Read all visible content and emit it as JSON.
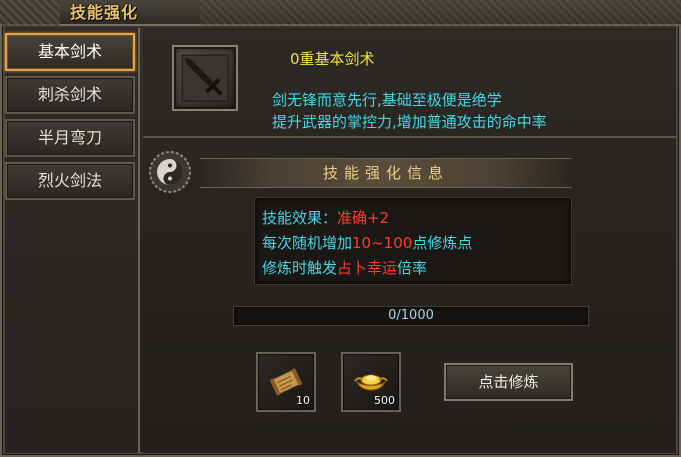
{
  "window": {
    "title": "技能强化"
  },
  "tabs": [
    {
      "label": "基本剑术",
      "active": true
    },
    {
      "label": "刺杀剑术",
      "active": false
    },
    {
      "label": "半月弯刀",
      "active": false
    },
    {
      "label": "烈火剑法",
      "active": false
    }
  ],
  "skill": {
    "icon": "sword-icon",
    "name": "0重基本剑术",
    "desc_line1": "剑无锋而意先行,基础至极便是绝学",
    "desc_line2": "提升武器的掌控力,增加普通攻击的命中率"
  },
  "info": {
    "header": "技能强化信息",
    "line1_label": "技能效果：",
    "line1_value": "准确+2",
    "line2_prefix": "每次随机增加",
    "line2_value": "10~100",
    "line2_suffix": "点修炼点",
    "line3_prefix": "修炼时触发",
    "line3_value": "占卜幸运",
    "line3_suffix": "倍率"
  },
  "progress": {
    "text": "0/1000",
    "current": 0,
    "max": 1000
  },
  "items": [
    {
      "icon": "scroll-icon",
      "count": "10"
    },
    {
      "icon": "gold-ingot-icon",
      "count": "500"
    }
  ],
  "actions": {
    "cultivate_label": "点击修炼"
  },
  "colors": {
    "accent_gold": "#e8c56a",
    "cyan_text": "#45d6e6",
    "red_text": "#ff3b2b",
    "yellow_name": "#f2e33a"
  }
}
